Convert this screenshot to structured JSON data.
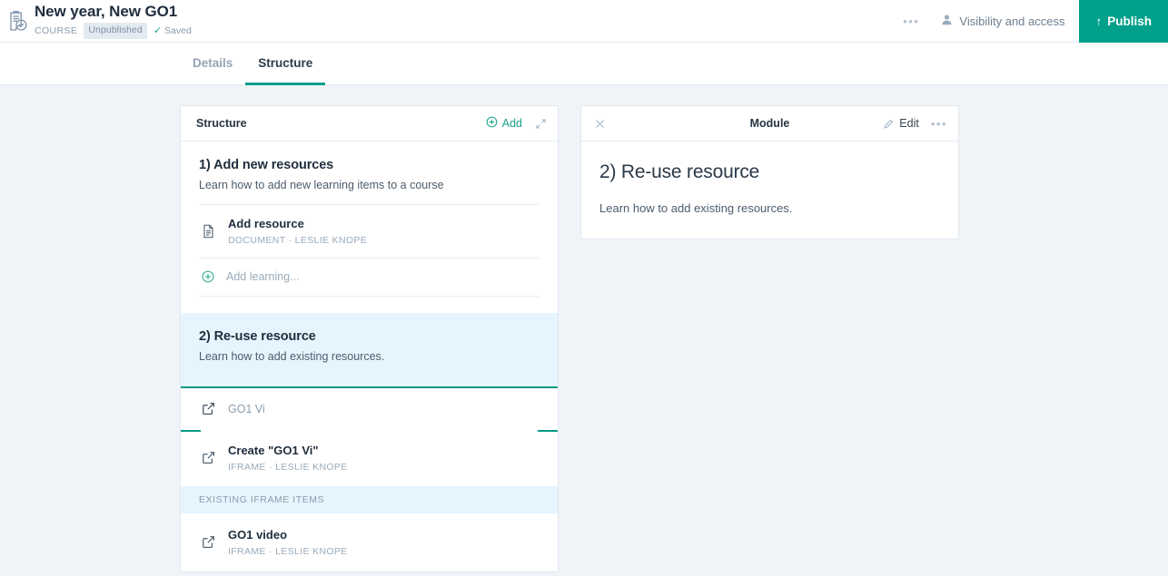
{
  "header": {
    "icon": "clipboard-check-icon",
    "title": "New year, New GO1",
    "type_label": "COURSE",
    "status_badge": "Unpublished",
    "saved_label": "Saved",
    "saved_tick": "✓",
    "overflow_label": "•••",
    "visibility_label": "Visibility and access",
    "visibility_icon": "person-icon",
    "publish_label": "Publish",
    "publish_arrow": "↑",
    "publish_color": "#00a08a"
  },
  "tabs": [
    {
      "label": "Details",
      "active": false
    },
    {
      "label": "Structure",
      "active": true
    }
  ],
  "structure_panel": {
    "title": "Structure",
    "add_label": "Add",
    "add_icon": "plus-circle-icon",
    "expand_icon": "expand-arrows-icon",
    "modules": [
      {
        "title": "1) Add new resources",
        "description": "Learn how to add new learning items to a course",
        "selected": false,
        "items": [
          {
            "icon": "document-icon",
            "title": "Add resource",
            "subtitle": "DOCUMENT · LESLIE KNOPE"
          }
        ],
        "add_learning_label": "Add learning...",
        "add_learning_icon": "plus-circle-icon"
      },
      {
        "title": "2) Re-use resource",
        "description": "Learn how to add existing resources.",
        "selected": true
      }
    ],
    "search": {
      "icon": "external-link-icon",
      "value": "GO1 Vi",
      "placeholder": "GO1 Vi"
    },
    "create_option": {
      "icon": "external-link-icon",
      "prefix": "Create \"",
      "term": "GO1 Vi",
      "suffix": "\"",
      "subtitle": "IFRAME · LESLIE KNOPE"
    },
    "existing_section": {
      "header": "EXISTING IFRAME ITEMS",
      "items": [
        {
          "icon": "external-link-icon",
          "title": "GO1 video",
          "subtitle": "IFRAME · LESLIE KNOPE"
        }
      ]
    }
  },
  "detail_panel": {
    "close_icon": "close-icon",
    "title": "Module",
    "edit_label": "Edit",
    "edit_icon": "pencil-icon",
    "overflow_label": "•••",
    "heading": "2) Re-use resource",
    "body": "Learn how to add existing resources."
  },
  "theme": {
    "accent": "#00a08a",
    "page_bg": "#f0f4f8",
    "selected_bg": "#e6f4fd"
  }
}
